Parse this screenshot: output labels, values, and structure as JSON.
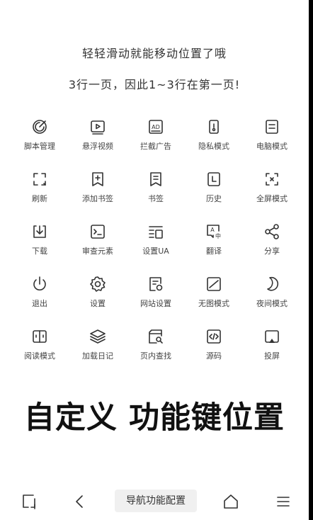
{
  "hints": {
    "line1": "轻轻滑动就能移动位置了哦",
    "line2": "3行一页，因此1~3行在第一页!"
  },
  "functions": [
    {
      "label": "脚本管理",
      "icon": "script-icon"
    },
    {
      "label": "悬浮视频",
      "icon": "floating-video-icon"
    },
    {
      "label": "拦截广告",
      "icon": "ad-block-icon"
    },
    {
      "label": "隐私模式",
      "icon": "privacy-icon"
    },
    {
      "label": "电脑模式",
      "icon": "desktop-mode-icon"
    },
    {
      "label": "刷新",
      "icon": "refresh-icon"
    },
    {
      "label": "添加书签",
      "icon": "add-bookmark-icon"
    },
    {
      "label": "书签",
      "icon": "bookmark-icon"
    },
    {
      "label": "历史",
      "icon": "history-icon"
    },
    {
      "label": "全屏模式",
      "icon": "fullscreen-icon"
    },
    {
      "label": "下载",
      "icon": "download-icon"
    },
    {
      "label": "审查元素",
      "icon": "inspect-element-icon"
    },
    {
      "label": "设置UA",
      "icon": "user-agent-icon"
    },
    {
      "label": "翻译",
      "icon": "translate-icon"
    },
    {
      "label": "分享",
      "icon": "share-icon"
    },
    {
      "label": "退出",
      "icon": "power-icon"
    },
    {
      "label": "设置",
      "icon": "gear-icon"
    },
    {
      "label": "网站设置",
      "icon": "site-settings-icon"
    },
    {
      "label": "无图模式",
      "icon": "no-image-icon"
    },
    {
      "label": "夜间模式",
      "icon": "moon-icon"
    },
    {
      "label": "阅读模式",
      "icon": "reader-mode-icon"
    },
    {
      "label": "加载日记",
      "icon": "layers-icon"
    },
    {
      "label": "页内查找",
      "icon": "find-in-page-icon"
    },
    {
      "label": "源码",
      "icon": "source-code-icon"
    },
    {
      "label": "投屏",
      "icon": "cast-icon"
    }
  ],
  "banner": "自定义 功能键位置",
  "navbar": {
    "config_label": "导航功能配置",
    "icons": [
      "tabs-icon",
      "back-icon",
      "home-icon",
      "menu-icon"
    ]
  }
}
